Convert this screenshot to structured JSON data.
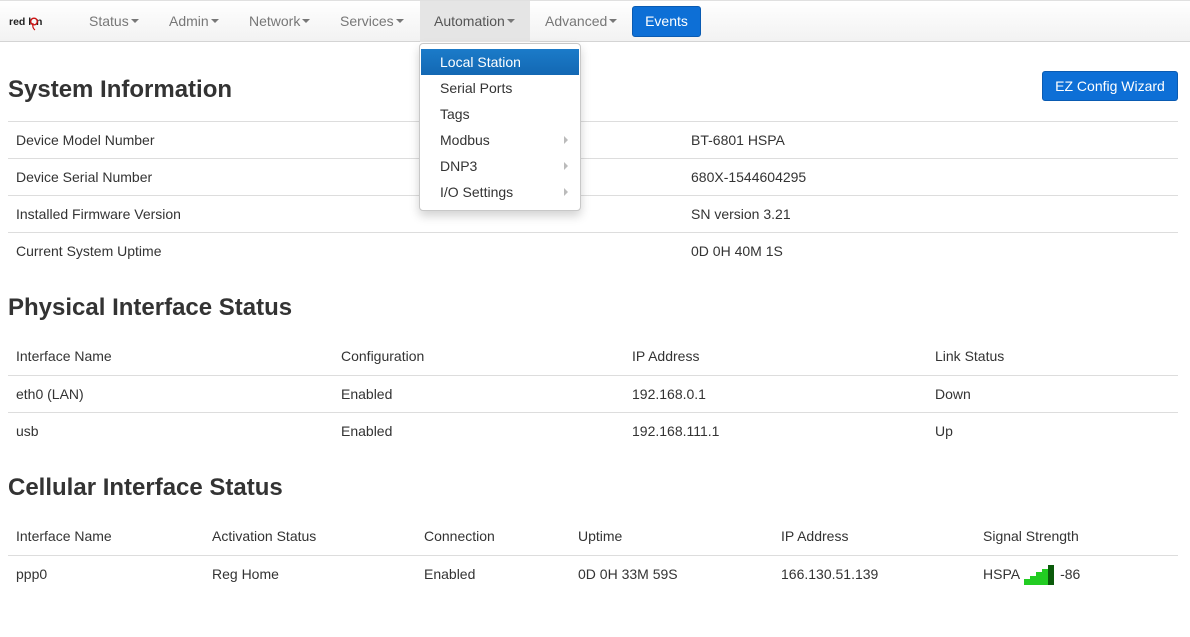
{
  "nav": {
    "logo": "red lion",
    "items": [
      {
        "label": "Status"
      },
      {
        "label": "Admin"
      },
      {
        "label": "Network"
      },
      {
        "label": "Services"
      },
      {
        "label": "Automation"
      },
      {
        "label": "Advanced"
      }
    ],
    "events_label": "Events"
  },
  "automation_menu": {
    "items": [
      {
        "label": "Local Station"
      },
      {
        "label": "Serial Ports"
      },
      {
        "label": "Tags"
      },
      {
        "label": "Modbus"
      },
      {
        "label": "DNP3"
      },
      {
        "label": "I/O Settings"
      }
    ]
  },
  "system_info": {
    "title": "System Information",
    "wizard_label": "EZ Config Wizard",
    "rows": [
      {
        "label": "Device Model Number",
        "value": "BT-6801 HSPA"
      },
      {
        "label": "Device Serial Number",
        "value": "680X-1544604295"
      },
      {
        "label": "Installed Firmware Version",
        "value": "SN version 3.21"
      },
      {
        "label": "Current System Uptime",
        "value": "0D 0H 40M 1S"
      }
    ]
  },
  "physical": {
    "title": "Physical Interface Status",
    "headers": [
      "Interface Name",
      "Configuration",
      "IP Address",
      "Link Status"
    ],
    "rows": [
      [
        "eth0 (LAN)",
        "Enabled",
        "192.168.0.1",
        "Down"
      ],
      [
        "usb",
        "Enabled",
        "192.168.111.1",
        "Up"
      ]
    ]
  },
  "cellular": {
    "title": "Cellular Interface Status",
    "headers": [
      "Interface Name",
      "Activation Status",
      "Connection",
      "Uptime",
      "IP Address",
      "Signal Strength"
    ],
    "rows": [
      [
        "ppp0",
        "Reg Home",
        "Enabled",
        "0D 0H 33M 59S",
        "166.130.51.139"
      ]
    ],
    "signal": {
      "tech": "HSPA",
      "dbm": "-86",
      "bars_lit": 4,
      "bars_total": 5
    },
    "colors": {
      "bar_lit": "#22cc22",
      "bar_dark": "#0a5a0a"
    }
  },
  "colors": {
    "accent": "#0d6fd6",
    "menu_selected": "#1b7bc9"
  }
}
